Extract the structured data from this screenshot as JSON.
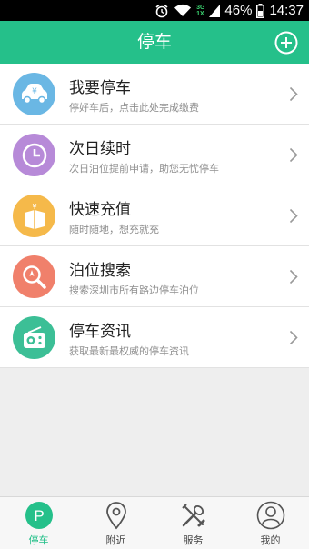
{
  "status_bar": {
    "network": [
      "3G",
      "1X"
    ],
    "battery": "46%",
    "time": "14:37"
  },
  "header": {
    "title": "停车"
  },
  "menu": [
    {
      "title": "我要停车",
      "subtitle": "停好车后，点击此处完成缴费",
      "icon": "car-payment-icon",
      "color": "#6ab7e4"
    },
    {
      "title": "次日续时",
      "subtitle": "次日泊位提前申请，助您无忧停车",
      "icon": "clock-icon",
      "color": "#b78ad8"
    },
    {
      "title": "快速充值",
      "subtitle": "随时随地，想充就充",
      "icon": "gift-box-icon",
      "color": "#f5b94a"
    },
    {
      "title": "泊位搜索",
      "subtitle": "搜索深圳市所有路边停车泊位",
      "icon": "search-icon",
      "color": "#f0806b"
    },
    {
      "title": "停车资讯",
      "subtitle": "获取最新最权威的停车资讯",
      "icon": "radio-icon",
      "color": "#3cbf96"
    }
  ],
  "tabs": [
    {
      "label": "停车",
      "icon": "parking-icon",
      "active": true
    },
    {
      "label": "附近",
      "icon": "location-pin-icon"
    },
    {
      "label": "服务",
      "icon": "tools-icon"
    },
    {
      "label": "我的",
      "icon": "user-icon"
    }
  ],
  "colors": {
    "brand": "#25c08a",
    "background": "#eeeeee"
  }
}
